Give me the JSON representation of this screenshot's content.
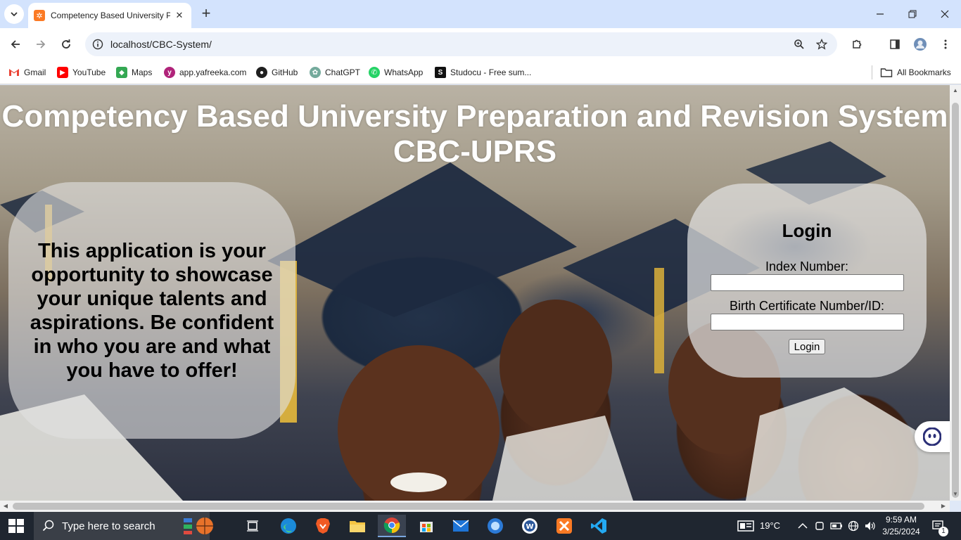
{
  "browser": {
    "tab": {
      "title": "Competency Based University P",
      "close": "✕"
    },
    "new_tab": "+",
    "url": "localhost/CBC-System/",
    "bookmarks": [
      {
        "label": "Gmail",
        "icon": "gmail-icon",
        "color": "#ea4335"
      },
      {
        "label": "YouTube",
        "icon": "youtube-icon",
        "color": "#ff0000"
      },
      {
        "label": "Maps",
        "icon": "maps-icon",
        "color": "#34a853"
      },
      {
        "label": "app.yafreeka.com",
        "icon": "yafreeka-icon",
        "color": "#b0247a"
      },
      {
        "label": "GitHub",
        "icon": "github-icon",
        "color": "#1f1f1f"
      },
      {
        "label": "ChatGPT",
        "icon": "chatgpt-icon",
        "color": "#74aa9c"
      },
      {
        "label": "WhatsApp",
        "icon": "whatsapp-icon",
        "color": "#25d366"
      },
      {
        "label": "Studocu - Free sum...",
        "icon": "studocu-icon",
        "color": "#111111"
      }
    ],
    "all_bookmarks": "All Bookmarks"
  },
  "page": {
    "heading_line1": "Competency Based University Preparation and Revision System",
    "heading_line2": "CBC-UPRS",
    "intro": "This application is your opportunity to showcase your unique talents and aspirations. Be confident in who you are and what you have to offer!",
    "login": {
      "title": "Login",
      "index_label": "Index Number:",
      "index_value": "",
      "birth_label": "Birth Certificate Number/ID:",
      "birth_value": "",
      "button": "Login"
    }
  },
  "taskbar": {
    "search_placeholder": "Type here to search",
    "weather": "19°C",
    "time": "9:59 AM",
    "date": "3/25/2024",
    "notification_count": "1"
  },
  "colors": {
    "accent": "#d3e3fd",
    "taskbar": "#1f2630",
    "xampp": "#fb7a24"
  }
}
